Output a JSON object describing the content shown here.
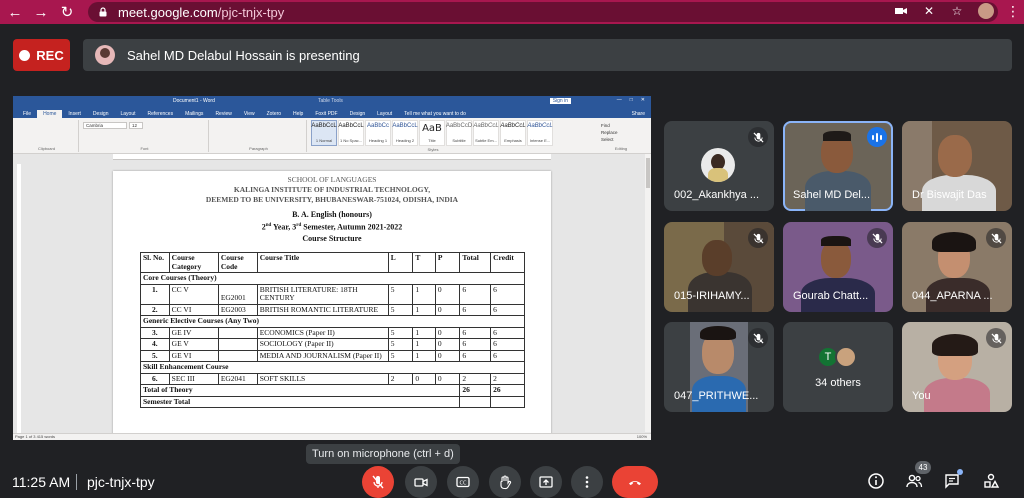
{
  "browser": {
    "url_host": "meet.google.com",
    "url_path": "/pjc-tnjx-tpy"
  },
  "meeting": {
    "rec_label": "REC",
    "presenting_text": "Sahel MD Delabul Hossain is presenting",
    "time": "11:25 AM",
    "code": "pjc-tnjx-tpy",
    "tooltip": "Turn on microphone (ctrl + d)",
    "participants_count": "43"
  },
  "word": {
    "doc_title": "Document1 - Word",
    "table_tools": "Table Tools",
    "sign_in": "Sign in",
    "tabs": [
      "File",
      "Home",
      "Insert",
      "Design",
      "Layout",
      "References",
      "Mailings",
      "Review",
      "View",
      "Zotero",
      "Help",
      "Foxit PDF",
      "Design",
      "Layout",
      "Tell me what you want to do"
    ],
    "font_name": "Cambria",
    "font_size": "12",
    "groups": [
      "Clipboard",
      "Font",
      "Paragraph",
      "Styles",
      "Editing"
    ],
    "styles": [
      {
        "preview": "AaBbCcL",
        "name": "1 Normal"
      },
      {
        "preview": "AaBbCcL",
        "name": "1 No Spac..."
      },
      {
        "preview": "AaBbCc",
        "name": "Heading 1"
      },
      {
        "preview": "AaBbCcL",
        "name": "Heading 2"
      },
      {
        "preview": "AaB",
        "name": "Title"
      },
      {
        "preview": "AaBbCcD",
        "name": "Subtitle"
      },
      {
        "preview": "AaBbCcL",
        "name": "Subtle Em..."
      },
      {
        "preview": "AaBbCcL",
        "name": "Emphasis"
      },
      {
        "preview": "AaBbCcL",
        "name": "Intense E..."
      }
    ],
    "editing": [
      "Find",
      "Replace",
      "Select"
    ],
    "share": "Share",
    "status_left": "Page 1 of 3   415 words",
    "zoom": "100%"
  },
  "document": {
    "org_line1": "SCHOOL OF LANGUAGES",
    "org_line2": "KALINGA INSTITUTE OF INDUSTRIAL TECHNOLOGY,",
    "org_line3": "DEEMED TO BE UNIVERSITY, BHUBANESWAR-751024, ODISHA, INDIA",
    "programme": "B. A. English (honours)",
    "year_a": "2",
    "year_sup_a": "nd",
    "year_b": " Year, 3",
    "year_sup_b": "rd",
    "year_c": " Semester, Autumn 2021-2022",
    "structure": "Course Structure",
    "headers": [
      "Sl. No.",
      "Course Category",
      "Course Code",
      "Course Title",
      "L",
      "T",
      "P",
      "Total",
      "Credit"
    ],
    "sec_core": "Core Courses (Theory)",
    "sec_ge": "Generic Elective Courses (Any Two)",
    "sec_skill": "Skill Enhancement Course",
    "total_theory": "Total of Theory",
    "semester_total": "Semester Total",
    "rows": [
      {
        "no": "1.",
        "cat": "CC V",
        "code": "EG2001",
        "title": "BRITISH LITERATURE: 18TH CENTURY",
        "l": "5",
        "t": "1",
        "p": "0",
        "total": "6",
        "credit": "6"
      },
      {
        "no": "2.",
        "cat": "CC VI",
        "code": "EG2003",
        "title": "BRITISH ROMANTIC LITERATURE",
        "l": "5",
        "t": "1",
        "p": "0",
        "total": "6",
        "credit": "6"
      },
      {
        "no": "3.",
        "cat": "GE IV",
        "code": "",
        "title": "ECONOMICS (Paper II)",
        "l": "5",
        "t": "1",
        "p": "0",
        "total": "6",
        "credit": "6"
      },
      {
        "no": "4.",
        "cat": "GE V",
        "code": "",
        "title": "SOCIOLOGY (Paper II)",
        "l": "5",
        "t": "1",
        "p": "0",
        "total": "6",
        "credit": "6"
      },
      {
        "no": "5.",
        "cat": "GE VI",
        "code": "",
        "title": "MEDIA AND JOURNALISM (Paper II)",
        "l": "5",
        "t": "1",
        "p": "0",
        "total": "6",
        "credit": "6"
      },
      {
        "no": "6.",
        "cat": "SEC III",
        "code": "EG2041",
        "title": "SOFT SKILLS",
        "l": "2",
        "t": "0",
        "p": "0",
        "total": "2",
        "credit": "2"
      }
    ],
    "total_theory_total": "26",
    "total_theory_credit": "26"
  },
  "participants": [
    {
      "name": "002_Akankhya ..."
    },
    {
      "name": "Sahel MD Del..."
    },
    {
      "name": "Dr Biswajit Das"
    },
    {
      "name": "015-IRIHAMY..."
    },
    {
      "name": "Gourab Chatt..."
    },
    {
      "name": "044_APARNA ..."
    },
    {
      "name": "047_PRITHWE..."
    },
    {
      "name": "34 others",
      "avatar_letter": "T"
    },
    {
      "name": "You"
    }
  ],
  "colors": {
    "browser_bar": "#a8174f",
    "meet_bg": "#202124",
    "tile_bg": "#3c4043",
    "rec": "#c5221f",
    "end_call": "#ea4335",
    "word_blue": "#2b579a"
  }
}
